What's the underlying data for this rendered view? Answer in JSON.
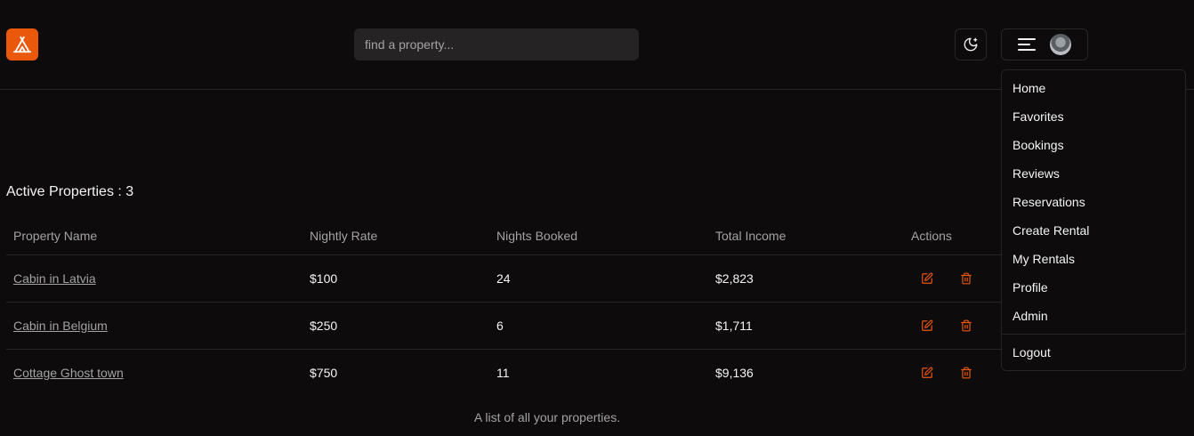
{
  "header": {
    "search_placeholder": "find a property..."
  },
  "main": {
    "heading": "Active Properties : 3",
    "columns": [
      "Property Name",
      "Nightly Rate",
      "Nights Booked",
      "Total Income",
      "Actions"
    ],
    "rows": [
      {
        "name": "Cabin in Latvia",
        "rate": "$100",
        "nights": "24",
        "income": "$2,823"
      },
      {
        "name": "Cabin in Belgium",
        "rate": "$250",
        "nights": "6",
        "income": "$1,711"
      },
      {
        "name": "Cottage Ghost town",
        "rate": "$750",
        "nights": "11",
        "income": "$9,136"
      }
    ],
    "caption": "A list of all your properties."
  },
  "menu": {
    "items": [
      "Home",
      "Favorites",
      "Bookings",
      "Reviews",
      "Reservations",
      "Create Rental",
      "My Rentals",
      "Profile",
      "Admin"
    ],
    "logout": "Logout"
  },
  "colors": {
    "accent": "#ea580c",
    "background": "#0d0b0c",
    "muted_text": "#a3a3a3"
  },
  "icons": {
    "logo": "tent-icon",
    "theme": "moon-stars-icon",
    "menu": "hamburger-icon",
    "edit": "edit-icon",
    "delete": "trash-icon"
  }
}
